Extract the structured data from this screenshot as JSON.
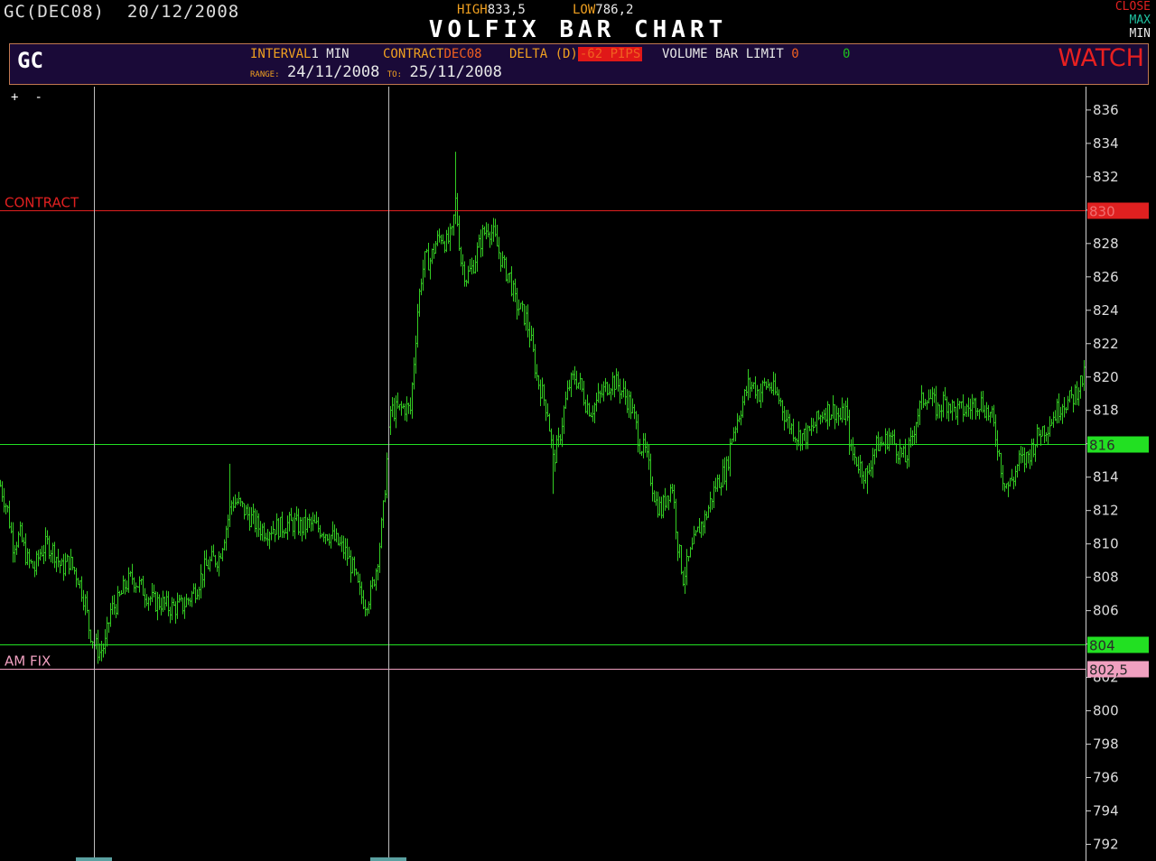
{
  "header": {
    "symbol_date": "GC(DEC08)  20/12/2008",
    "high_label": "HIGH",
    "high_value": "833,5",
    "low_label": "LOW",
    "low_value": "786,2",
    "title": "VOLFIX BAR CHART",
    "window_controls": [
      "CLOSE",
      "MAX",
      "MIN"
    ]
  },
  "panel": {
    "symbol": "GC",
    "interval_label": "INTERVAL",
    "interval_value": "1 MIN",
    "contract_label": "CONTRACT",
    "contract_value": "DEC08",
    "delta_label": "DELTA (D)",
    "delta_value": "-62 PIPS",
    "volume_label": "VOLUME BAR LIMIT",
    "volume_value": "0",
    "volume_value2": "0",
    "range_label": "RANGE:",
    "range_from": "24/11/2008",
    "to_label": "TO:",
    "range_to": "25/11/2008",
    "watch_label": "WATCH"
  },
  "zoom": {
    "plus": "+",
    "minus": "-"
  },
  "colors": {
    "bars": "#33cc22",
    "contract": "#e02020",
    "green_level": "#22e022",
    "amfix": "#f0a0c0",
    "panel_bg": "#1a0a38"
  },
  "chart_data": {
    "type": "bar",
    "y_ticks": [
      "792",
      "794",
      "796",
      "798",
      "800",
      "802",
      "804",
      "806",
      "808",
      "810",
      "812",
      "814",
      "816",
      "818",
      "820",
      "822",
      "824",
      "826",
      "828",
      "830",
      "832",
      "834",
      "836"
    ],
    "ylim": [
      791,
      837.4
    ],
    "levels": [
      {
        "name": "CONTRACT",
        "value": 830,
        "label": "830",
        "color": "#e02020"
      },
      {
        "name": "",
        "value": 816,
        "label": "816",
        "color": "#22e022"
      },
      {
        "name": "",
        "value": 804,
        "label": "804",
        "color": "#22e022"
      },
      {
        "name": "AM FIX",
        "value": 802.5,
        "label": "802,5",
        "color": "#f0a0c0"
      }
    ],
    "anchors": [
      [
        0,
        813.5
      ],
      [
        8,
        812
      ],
      [
        14,
        810
      ],
      [
        22,
        810.5
      ],
      [
        30,
        809
      ],
      [
        38,
        808.5
      ],
      [
        44,
        809.5
      ],
      [
        52,
        810
      ],
      [
        60,
        809.5
      ],
      [
        68,
        808.5
      ],
      [
        76,
        809
      ],
      [
        86,
        808
      ],
      [
        94,
        806.5
      ],
      [
        98,
        805
      ],
      [
        104,
        804
      ],
      [
        110,
        803.5
      ],
      [
        116,
        804
      ],
      [
        122,
        806
      ],
      [
        130,
        806.5
      ],
      [
        138,
        807.5
      ],
      [
        146,
        808
      ],
      [
        154,
        807.5
      ],
      [
        162,
        807
      ],
      [
        170,
        806.5
      ],
      [
        178,
        806.5
      ],
      [
        186,
        806.2
      ],
      [
        194,
        806.2
      ],
      [
        202,
        806.3
      ],
      [
        210,
        806.8
      ],
      [
        218,
        807.5
      ],
      [
        226,
        808.5
      ],
      [
        234,
        809
      ],
      [
        242,
        809.2
      ],
      [
        250,
        811
      ],
      [
        256,
        812.5
      ],
      [
        262,
        812.5
      ],
      [
        270,
        812
      ],
      [
        278,
        811.5
      ],
      [
        286,
        811
      ],
      [
        294,
        810.8
      ],
      [
        302,
        811
      ],
      [
        310,
        811
      ],
      [
        318,
        811.2
      ],
      [
        326,
        811.2
      ],
      [
        334,
        811
      ],
      [
        342,
        811.2
      ],
      [
        350,
        811
      ],
      [
        358,
        810.8
      ],
      [
        366,
        810.5
      ],
      [
        374,
        810
      ],
      [
        382,
        809.5
      ],
      [
        390,
        808.5
      ],
      [
        398,
        807
      ],
      [
        404,
        806.5
      ],
      [
        410,
        807
      ],
      [
        416,
        808.5
      ],
      [
        420,
        810
      ],
      [
        424,
        812
      ],
      [
        428,
        815
      ],
      [
        432,
        818
      ],
      [
        440,
        818
      ],
      [
        448,
        818.2
      ],
      [
        454,
        818
      ],
      [
        458,
        821
      ],
      [
        462,
        824
      ],
      [
        466,
        826
      ],
      [
        470,
        827
      ],
      [
        476,
        827
      ],
      [
        482,
        828
      ],
      [
        488,
        828.5
      ],
      [
        494,
        828
      ],
      [
        500,
        828.5
      ],
      [
        504,
        830.5
      ],
      [
        510,
        827
      ],
      [
        516,
        826
      ],
      [
        522,
        826.5
      ],
      [
        528,
        827.5
      ],
      [
        534,
        828.5
      ],
      [
        540,
        829
      ],
      [
        546,
        828.5
      ],
      [
        552,
        827.5
      ],
      [
        558,
        826.5
      ],
      [
        564,
        826
      ],
      [
        570,
        824.5
      ],
      [
        576,
        824
      ],
      [
        582,
        823.5
      ],
      [
        588,
        822
      ],
      [
        594,
        820
      ],
      [
        600,
        819
      ],
      [
        606,
        818
      ],
      [
        612,
        815
      ],
      [
        618,
        816
      ],
      [
        624,
        818
      ],
      [
        630,
        819.5
      ],
      [
        636,
        820
      ],
      [
        642,
        819.5
      ],
      [
        648,
        818.5
      ],
      [
        654,
        818
      ],
      [
        660,
        818.5
      ],
      [
        666,
        819
      ],
      [
        672,
        819.5
      ],
      [
        678,
        819.8
      ],
      [
        684,
        819.5
      ],
      [
        690,
        819
      ],
      [
        696,
        818.5
      ],
      [
        702,
        817.5
      ],
      [
        708,
        816
      ],
      [
        714,
        815.5
      ],
      [
        720,
        814
      ],
      [
        726,
        812.5
      ],
      [
        732,
        812
      ],
      [
        738,
        813
      ],
      [
        744,
        813.5
      ],
      [
        750,
        810
      ],
      [
        756,
        808
      ],
      [
        762,
        809
      ],
      [
        768,
        810
      ],
      [
        774,
        811
      ],
      [
        780,
        811.5
      ],
      [
        786,
        812.5
      ],
      [
        792,
        813.5
      ],
      [
        798,
        814
      ],
      [
        804,
        814.5
      ],
      [
        810,
        816.5
      ],
      [
        816,
        817.5
      ],
      [
        822,
        818.5
      ],
      [
        828,
        819.5
      ],
      [
        834,
        819.5
      ],
      [
        840,
        819
      ],
      [
        846,
        819.5
      ],
      [
        852,
        819.5
      ],
      [
        858,
        819
      ],
      [
        864,
        818.5
      ],
      [
        870,
        817.5
      ],
      [
        876,
        817
      ],
      [
        882,
        816.5
      ],
      [
        888,
        816.5
      ],
      [
        894,
        816.5
      ],
      [
        900,
        817
      ],
      [
        906,
        817.5
      ],
      [
        912,
        818
      ],
      [
        918,
        818
      ],
      [
        924,
        818
      ],
      [
        930,
        817.5
      ],
      [
        936,
        818
      ],
      [
        942,
        815.5
      ],
      [
        948,
        815
      ],
      [
        954,
        814.5
      ],
      [
        960,
        814
      ],
      [
        966,
        815.5
      ],
      [
        972,
        816
      ],
      [
        978,
        816
      ],
      [
        984,
        816.5
      ],
      [
        990,
        816
      ],
      [
        996,
        815.5
      ],
      [
        1002,
        815
      ],
      [
        1008,
        816
      ],
      [
        1014,
        817.5
      ],
      [
        1020,
        818.5
      ],
      [
        1026,
        819
      ],
      [
        1032,
        818.5
      ],
      [
        1038,
        818
      ],
      [
        1044,
        818.5
      ],
      [
        1050,
        818.5
      ],
      [
        1056,
        818
      ],
      [
        1062,
        818
      ],
      [
        1068,
        818
      ],
      [
        1074,
        818.2
      ],
      [
        1080,
        818.5
      ],
      [
        1086,
        818.5
      ],
      [
        1092,
        818
      ],
      [
        1098,
        817.5
      ],
      [
        1104,
        816
      ],
      [
        1110,
        814
      ],
      [
        1116,
        813.5
      ],
      [
        1122,
        814
      ],
      [
        1128,
        815
      ],
      [
        1134,
        815
      ],
      [
        1140,
        815.5
      ],
      [
        1146,
        816.2
      ],
      [
        1152,
        816.8
      ],
      [
        1158,
        817
      ],
      [
        1164,
        817.5
      ],
      [
        1170,
        818
      ],
      [
        1176,
        818.5
      ],
      [
        1182,
        818.5
      ],
      [
        1188,
        818.8
      ],
      [
        1194,
        819.5
      ],
      [
        1200,
        820
      ],
      [
        1206,
        820.5
      ],
      [
        1212,
        820.5
      ],
      [
        1218,
        820
      ],
      [
        1224,
        819.5
      ],
      [
        1230,
        820
      ],
      [
        1236,
        819
      ],
      [
        1242,
        818.5
      ],
      [
        1248,
        817.5
      ],
      [
        1254,
        817.5
      ],
      [
        1260,
        818
      ],
      [
        1266,
        818
      ],
      [
        1272,
        819
      ],
      [
        1280,
        819.2
      ]
    ],
    "spikes": [
      {
        "x": 504,
        "high": 833.5
      },
      {
        "x": 755,
        "low": 805.2
      },
      {
        "x": 612,
        "low": 813
      },
      {
        "x": 110,
        "low": 803
      },
      {
        "x": 254,
        "high": 814.8
      },
      {
        "x": 960,
        "low": 813
      },
      {
        "x": 1116,
        "low": 812.8
      },
      {
        "x": 1210,
        "high": 821.5
      }
    ],
    "cursor_lines": [
      104,
      430
    ]
  }
}
